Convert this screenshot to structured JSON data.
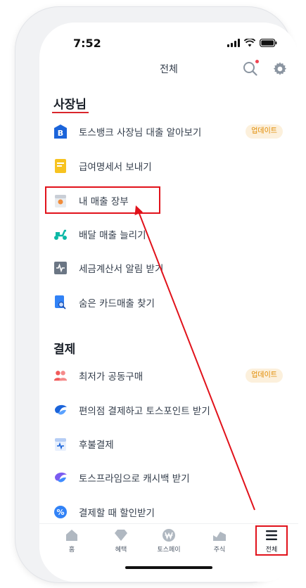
{
  "status_bar": {
    "time": "7:52"
  },
  "header": {
    "title": "전체"
  },
  "sections": [
    {
      "title": "사장님",
      "items": [
        {
          "label": "토스뱅크 사장님 대출 알아보기",
          "icon": "toss-bank-icon",
          "badge": "업데이트"
        },
        {
          "label": "급여명세서 보내기",
          "icon": "payslip-icon"
        },
        {
          "label": "내 매출 장부",
          "icon": "sales-ledger-icon"
        },
        {
          "label": "배달 매출 늘리기",
          "icon": "delivery-scooter-icon"
        },
        {
          "label": "세금계산서 알림 받기",
          "icon": "tax-invoice-icon"
        },
        {
          "label": "숨은 카드매출 찾기",
          "icon": "card-search-icon"
        }
      ]
    },
    {
      "title": "결제",
      "items": [
        {
          "label": "최저가 공동구매",
          "icon": "group-buy-icon",
          "badge": "업데이트"
        },
        {
          "label": "편의점 결제하고 토스포인트 받기",
          "icon": "toss-pay-icon"
        },
        {
          "label": "후불결제",
          "icon": "deferred-payment-icon"
        },
        {
          "label": "토스프라임으로 캐시백 받기",
          "icon": "toss-prime-icon"
        },
        {
          "label": "결제할 때 할인받기",
          "icon": "discount-percent-icon"
        }
      ]
    }
  ],
  "tab_bar": {
    "tabs": [
      {
        "label": "홈",
        "icon": "home-icon"
      },
      {
        "label": "혜택",
        "icon": "benefit-diamond-icon"
      },
      {
        "label": "토스페이",
        "icon": "toss-pay-won-icon"
      },
      {
        "label": "주식",
        "icon": "stock-chart-icon"
      },
      {
        "label": "전체",
        "icon": "menu-icon"
      }
    ]
  },
  "colors": {
    "annotation_red": "#e1121b",
    "badge_bg": "#fcf0dc",
    "badge_text": "#e08a00",
    "toss_blue": "#1b64da"
  }
}
